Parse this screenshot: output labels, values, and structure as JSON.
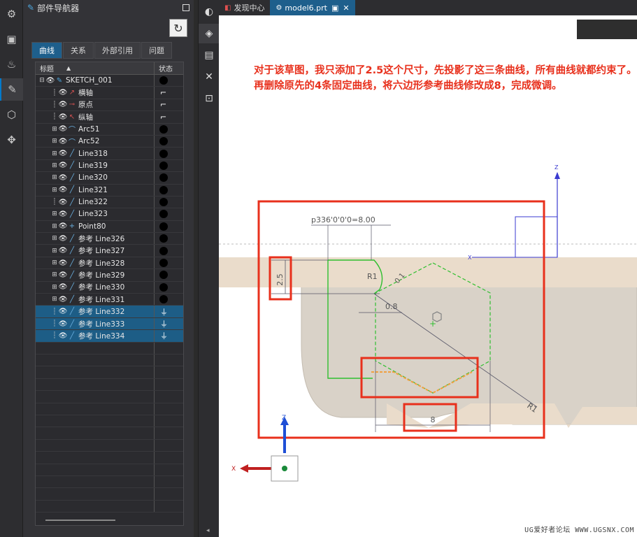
{
  "navigator": {
    "title": "部件导航器",
    "tabs": [
      "曲线",
      "关系",
      "外部引用",
      "问题"
    ],
    "columns": {
      "name": "标题",
      "status": "状态"
    },
    "rows": [
      {
        "label": "SKETCH_001",
        "icon": "sketch-icon",
        "level": 0,
        "exp": "⊟",
        "status": "dot",
        "selected": false
      },
      {
        "label": "横轴",
        "icon": "x-axis-icon",
        "level": 1,
        "exp": "",
        "status": "bracket",
        "selected": false
      },
      {
        "label": "原点",
        "icon": "origin-icon",
        "level": 1,
        "exp": "",
        "status": "bracket",
        "selected": false
      },
      {
        "label": "纵轴",
        "icon": "y-axis-icon",
        "level": 1,
        "exp": "",
        "status": "bracket",
        "selected": false
      },
      {
        "label": "Arc51",
        "icon": "arc-icon",
        "level": 1,
        "exp": "⊞",
        "status": "dot",
        "selected": false
      },
      {
        "label": "Arc52",
        "icon": "arc-icon",
        "level": 1,
        "exp": "⊞",
        "status": "dot",
        "selected": false
      },
      {
        "label": "Line318",
        "icon": "line-icon",
        "level": 1,
        "exp": "⊞",
        "status": "dot",
        "selected": false
      },
      {
        "label": "Line319",
        "icon": "line-icon",
        "level": 1,
        "exp": "⊞",
        "status": "dot",
        "selected": false
      },
      {
        "label": "Line320",
        "icon": "line-icon",
        "level": 1,
        "exp": "⊞",
        "status": "dot",
        "selected": false
      },
      {
        "label": "Line321",
        "icon": "line-icon",
        "level": 1,
        "exp": "⊞",
        "status": "dot",
        "selected": false
      },
      {
        "label": "Line322",
        "icon": "line-icon",
        "level": 1,
        "exp": "",
        "status": "dot",
        "selected": false
      },
      {
        "label": "Line323",
        "icon": "line-icon",
        "level": 1,
        "exp": "⊞",
        "status": "dot",
        "selected": false
      },
      {
        "label": "Point80",
        "icon": "point-icon",
        "level": 1,
        "exp": "⊞",
        "status": "dot",
        "selected": false
      },
      {
        "label": "参考 Line326",
        "icon": "line-icon",
        "level": 1,
        "exp": "⊞",
        "status": "dot",
        "selected": false
      },
      {
        "label": "参考 Line327",
        "icon": "line-icon",
        "level": 1,
        "exp": "⊞",
        "status": "dot",
        "selected": false
      },
      {
        "label": "参考 Line328",
        "icon": "line-icon",
        "level": 1,
        "exp": "⊞",
        "status": "dot",
        "selected": false
      },
      {
        "label": "参考 Line329",
        "icon": "line-icon",
        "level": 1,
        "exp": "⊞",
        "status": "dot",
        "selected": false
      },
      {
        "label": "参考 Line330",
        "icon": "line-icon",
        "level": 1,
        "exp": "⊞",
        "status": "dot",
        "selected": false
      },
      {
        "label": "参考 Line331",
        "icon": "line-icon",
        "level": 1,
        "exp": "⊞",
        "status": "dot",
        "selected": false
      },
      {
        "label": "参考 Line332",
        "icon": "line-icon",
        "level": 1,
        "exp": "",
        "status": "ground",
        "selected": true
      },
      {
        "label": "参考 Line333",
        "icon": "line-icon",
        "level": 1,
        "exp": "",
        "status": "ground",
        "selected": true
      },
      {
        "label": "参考 Line334",
        "icon": "line-icon",
        "level": 1,
        "exp": "",
        "status": "ground",
        "selected": true
      }
    ]
  },
  "doc_tabs": [
    {
      "label": "发现中心",
      "active": false
    },
    {
      "label": "model6.prt",
      "active": true
    }
  ],
  "annotation": "对于该草图，我只添加了2.5这个尺寸，先投影了这三条曲线，所有曲线就都约束了。再删除原先的4条固定曲线，将六边形参考曲线修改成8，完成微调。",
  "dimensions": {
    "angle": "p336'0'0'0=8.00",
    "height": "2.5",
    "r1_top": "R1",
    "r01": "0.1",
    "d08": "0.8",
    "hex_width": "8",
    "r1_diag": "R1"
  },
  "triad": {
    "z": "Z",
    "x": "X"
  },
  "watermark": "UG爱好者论坛 WWW.UGSNX.COM",
  "colors": {
    "highlight_red": "#e8301c",
    "sketch_green": "#2fbf2f",
    "orange": "#f0a040",
    "beige": "#eadccb",
    "accent_blue": "#1e5f8c"
  }
}
